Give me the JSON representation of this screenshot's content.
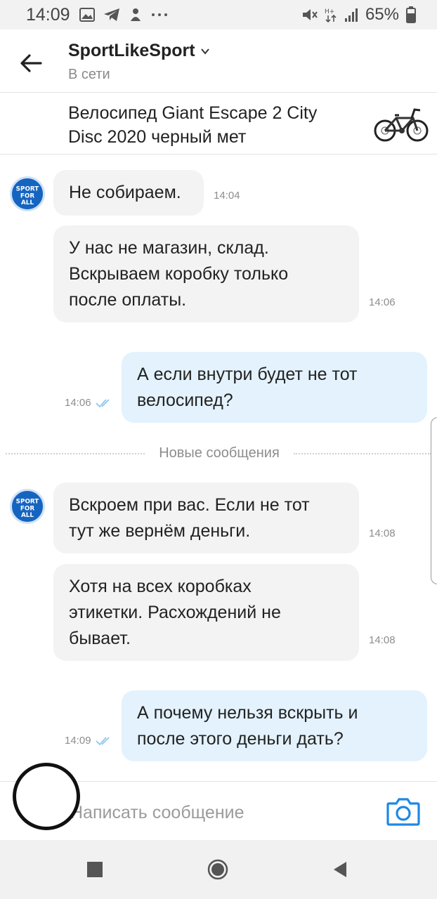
{
  "status_bar": {
    "time": "14:09",
    "battery": "65%"
  },
  "header": {
    "title": "SportLikeSport",
    "subtitle": "В сети"
  },
  "product": {
    "title": "Велосипед Giant Escape 2 City Disc 2020 черный мет"
  },
  "messages": [
    {
      "dir": "in",
      "text": "Не собираем.",
      "time": "14:04"
    },
    {
      "dir": "in",
      "text": "У нас не магазин, склад.\nВскрываем коробку только\nпосле оплаты.",
      "time": "14:06"
    },
    {
      "dir": "out",
      "text": "А если внутри будет не тот\nвелосипед?",
      "time": "14:06"
    },
    {
      "dir": "in",
      "text": "Вскроем при вас. Если не тот\nтут же вернём деньги.",
      "time": "14:08"
    },
    {
      "dir": "in",
      "text": "Хотя на всех коробках\nэтикетки. Расхождений не\nбывает.",
      "time": "14:08"
    },
    {
      "dir": "out",
      "text": "А почему нельзя вскрыть и\nпосле этого деньги дать?",
      "time": "14:09"
    }
  ],
  "divider_label": "Новые сообщения",
  "input": {
    "placeholder": "Написать сообщение"
  },
  "colors": {
    "accent": "#1e88e5",
    "incoming_bubble": "#f3f3f3",
    "outgoing_bubble": "#e3f2fc",
    "read_check": "#8ec8ef"
  }
}
